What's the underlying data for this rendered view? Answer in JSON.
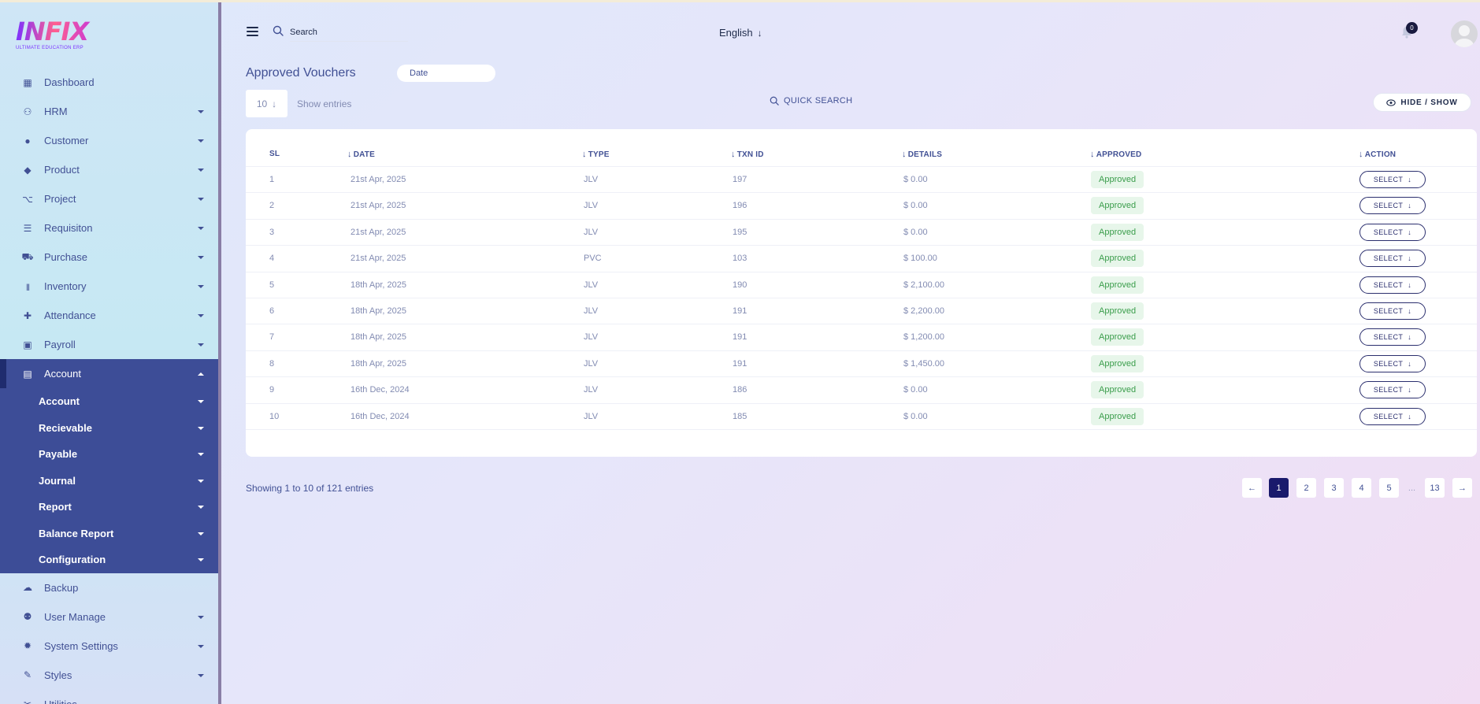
{
  "sidebar": {
    "logo_text": "INFIX",
    "logo_subtitle": "ULTIMATE EDUCATION ERP",
    "items": [
      {
        "label": "Dashboard",
        "icon": "dashboard-icon",
        "has_caret": false
      },
      {
        "label": "HRM",
        "icon": "hrm-icon",
        "has_caret": true
      },
      {
        "label": "Customer",
        "icon": "user-icon",
        "has_caret": true
      },
      {
        "label": "Product",
        "icon": "tag-icon",
        "has_caret": true
      },
      {
        "label": "Project",
        "icon": "project-icon",
        "has_caret": true
      },
      {
        "label": "Requisiton",
        "icon": "list-icon",
        "has_caret": true
      },
      {
        "label": "Purchase",
        "icon": "cart-icon",
        "has_caret": true
      },
      {
        "label": "Inventory",
        "icon": "barcode-icon",
        "has_caret": true
      },
      {
        "label": "Attendance",
        "icon": "user-check-icon",
        "has_caret": true
      },
      {
        "label": "Payroll",
        "icon": "money-icon",
        "has_caret": true
      },
      {
        "label": "Account",
        "icon": "calculator-icon",
        "has_caret": true,
        "active": true
      }
    ],
    "account_subitems": [
      "Account",
      "Recievable",
      "Payable",
      "Journal",
      "Report",
      "Balance Report",
      "Configuration"
    ],
    "items_after": [
      {
        "label": "Backup",
        "icon": "cloud-download-icon",
        "has_caret": false
      },
      {
        "label": "User Manage",
        "icon": "users-icon",
        "has_caret": true
      },
      {
        "label": "System Settings",
        "icon": "gear-icon",
        "has_caret": true
      },
      {
        "label": "Styles",
        "icon": "brush-icon",
        "has_caret": true
      },
      {
        "label": "Utilities",
        "icon": "tools-icon",
        "has_caret": false
      }
    ]
  },
  "header": {
    "search_placeholder": "Search",
    "language": "English",
    "notification_count": "0"
  },
  "page": {
    "title": "Approved Vouchers",
    "date_placeholder": "Date",
    "entries_value": "10",
    "show_entries_label": "Show entries",
    "quick_search_label": "QUICK SEARCH",
    "hide_show_label": "HIDE / SHOW"
  },
  "table": {
    "columns": [
      "SL",
      "DATE",
      "TYPE",
      "TXN ID",
      "DETAILS",
      "APPROVED",
      "ACTION"
    ],
    "rows": [
      {
        "sl": "1",
        "date": "21st Apr, 2025",
        "type": "JLV",
        "txn": "197",
        "details": "$ 0.00",
        "approved": "Approved",
        "action": "SELECT"
      },
      {
        "sl": "2",
        "date": "21st Apr, 2025",
        "type": "JLV",
        "txn": "196",
        "details": "$ 0.00",
        "approved": "Approved",
        "action": "SELECT"
      },
      {
        "sl": "3",
        "date": "21st Apr, 2025",
        "type": "JLV",
        "txn": "195",
        "details": "$ 0.00",
        "approved": "Approved",
        "action": "SELECT"
      },
      {
        "sl": "4",
        "date": "21st Apr, 2025",
        "type": "PVC",
        "txn": "103",
        "details": "$ 100.00",
        "approved": "Approved",
        "action": "SELECT"
      },
      {
        "sl": "5",
        "date": "18th Apr, 2025",
        "type": "JLV",
        "txn": "190",
        "details": "$ 2,100.00",
        "approved": "Approved",
        "action": "SELECT"
      },
      {
        "sl": "6",
        "date": "18th Apr, 2025",
        "type": "JLV",
        "txn": "191",
        "details": "$ 2,200.00",
        "approved": "Approved",
        "action": "SELECT"
      },
      {
        "sl": "7",
        "date": "18th Apr, 2025",
        "type": "JLV",
        "txn": "191",
        "details": "$ 1,200.00",
        "approved": "Approved",
        "action": "SELECT"
      },
      {
        "sl": "8",
        "date": "18th Apr, 2025",
        "type": "JLV",
        "txn": "191",
        "details": "$ 1,450.00",
        "approved": "Approved",
        "action": "SELECT"
      },
      {
        "sl": "9",
        "date": "16th Dec, 2024",
        "type": "JLV",
        "txn": "186",
        "details": "$ 0.00",
        "approved": "Approved",
        "action": "SELECT"
      },
      {
        "sl": "10",
        "date": "16th Dec, 2024",
        "type": "JLV",
        "txn": "185",
        "details": "$ 0.00",
        "approved": "Approved",
        "action": "SELECT"
      }
    ]
  },
  "pagination": {
    "summary": "Showing 1 to 10 of 121 entries",
    "pages": [
      "1",
      "2",
      "3",
      "4",
      "5",
      "...",
      "13"
    ],
    "current": "1",
    "prev_icon": "arrow-left-icon",
    "next_icon": "arrow-right-icon"
  },
  "colors": {
    "primary": "#415094",
    "active_nav": "#3d4d97",
    "approved_text": "#3a9d4b",
    "approved_bg": "#e7f6ea",
    "pager_active": "#1a1a6c"
  }
}
